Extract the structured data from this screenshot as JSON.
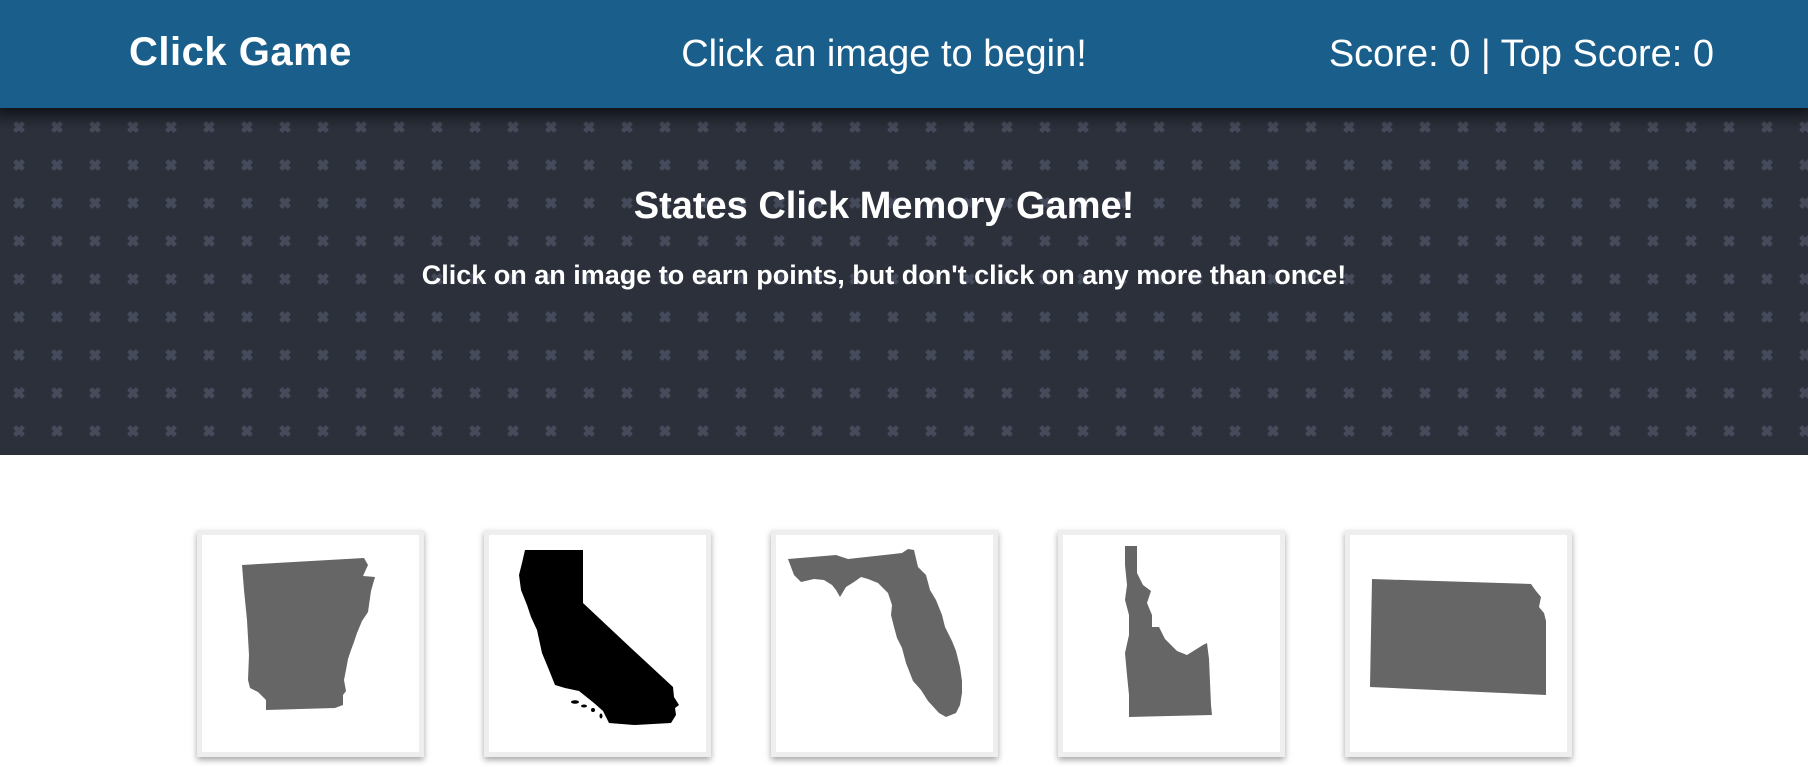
{
  "navbar": {
    "brand": "Click Game",
    "message": "Click an image to begin!",
    "score_text": "Score: 0 | Top Score: 0",
    "color": "#1a5e8c"
  },
  "jumbotron": {
    "title": "States Click Memory Game!",
    "subtitle": "Click on an image to earn points, but don't click on any more than once!"
  },
  "cards": [
    {
      "state": "Arkansas",
      "icon": "arkansas-shape",
      "fill": "#666666"
    },
    {
      "state": "California",
      "icon": "california-shape",
      "fill": "#000000"
    },
    {
      "state": "Florida",
      "icon": "florida-shape",
      "fill": "#666666"
    },
    {
      "state": "Idaho",
      "icon": "idaho-shape",
      "fill": "#666666"
    },
    {
      "state": "Kansas",
      "icon": "kansas-shape",
      "fill": "#666666"
    }
  ]
}
